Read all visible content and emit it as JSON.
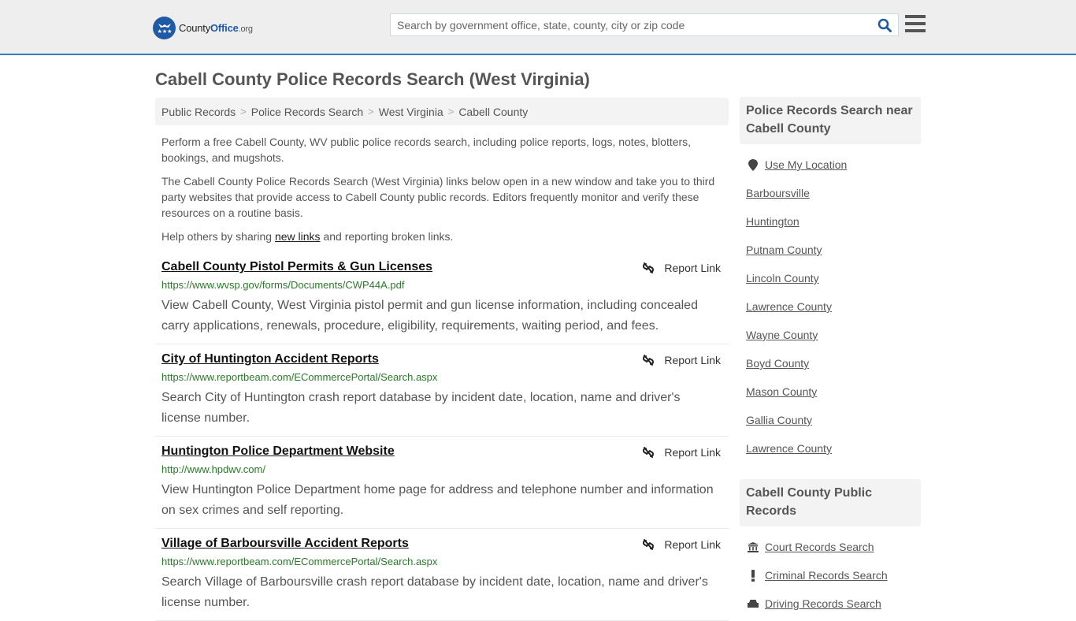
{
  "header": {
    "logo": {
      "part1": "County",
      "part2": "Office",
      "part3": ".org"
    },
    "search": {
      "placeholder": "Search by government office, state, county, city or zip code",
      "value": ""
    },
    "search_icon": "search-icon",
    "menu_icon": "hamburger-menu-icon"
  },
  "page": {
    "title": "Cabell County Police Records Search (West Virginia)"
  },
  "breadcrumb": [
    {
      "label": "Public Records"
    },
    {
      "label": "Police Records Search"
    },
    {
      "label": "West Virginia"
    },
    {
      "label": "Cabell County"
    }
  ],
  "breadcrumb_separator": ">",
  "intro": {
    "p1": "Perform a free Cabell County, WV public police records search, including police reports, logs, notes, blotters, bookings, and mugshots.",
    "p2": "The Cabell County Police Records Search (West Virginia) links below open in a new window and take you to third party websites that provide access to Cabell County public records. Editors frequently monitor and verify these resources on a routine basis.",
    "p3_before": "Help others by sharing ",
    "p3_link": "new links",
    "p3_after": " and reporting broken links."
  },
  "report_link_label": "Report Link",
  "results": [
    {
      "title": "Cabell County Pistol Permits & Gun Licenses",
      "url": "https://www.wvsp.gov/forms/Documents/CWP44A.pdf",
      "description": "View Cabell County, West Virginia pistol permit and gun license information, including concealed carry applications, renewals, procedure, eligibility, requirements, waiting period, and fees."
    },
    {
      "title": "City of Huntington Accident Reports",
      "url": "https://www.reportbeam.com/ECommercePortal/Search.aspx",
      "description": "Search City of Huntington crash report database by incident date, location, name and driver's license number."
    },
    {
      "title": "Huntington Police Department Website",
      "url": "http://www.hpdwv.com/",
      "description": "View Huntington Police Department home page for address and telephone number and information on sex crimes and self reporting."
    },
    {
      "title": "Village of Barboursville Accident Reports",
      "url": "https://www.reportbeam.com/ECommercePortal/Search.aspx",
      "description": "Search Village of Barboursville crash report database by incident date, location, name and driver's license number."
    }
  ],
  "sidebar": {
    "nearby": {
      "heading": "Police Records Search near Cabell County",
      "use_location": "Use My Location",
      "links": [
        "Barboursville",
        "Huntington",
        "Putnam County",
        "Lincoln County",
        "Lawrence County",
        "Wayne County",
        "Boyd County",
        "Mason County",
        "Gallia County",
        "Lawrence County"
      ]
    },
    "public_records": {
      "heading": "Cabell County Public Records",
      "links": [
        {
          "label": "Court Records Search",
          "icon": "courthouse-icon"
        },
        {
          "label": "Criminal Records Search",
          "icon": "exclamation-icon"
        },
        {
          "label": "Driving Records Search",
          "icon": "car-icon"
        }
      ]
    }
  }
}
